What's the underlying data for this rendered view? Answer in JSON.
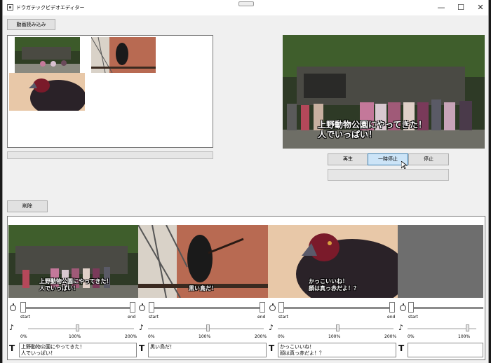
{
  "window": {
    "title": "ドウガテックビデオエディター"
  },
  "controls": {
    "minimize": "—",
    "maximize": "☐",
    "close": "✕"
  },
  "toolbar": {
    "load_label": "動画読み込み",
    "delete_label": "削除"
  },
  "player": {
    "subtitle": "上野動物公園にやってきた！\n人でいっぱい！",
    "play_label": "再生",
    "pause_label": "一時停止",
    "stop_label": "停止"
  },
  "timeline": {
    "start_label": "start",
    "end_label": "end",
    "vol_min": "0%",
    "vol_mid": "100%",
    "vol_max": "200%",
    "clips": [
      {
        "subtitle": "上野動物公園にやってきた！\n人でいっぱい！",
        "text": "上野動物公園にやってきた！\n人でいっぱい！",
        "has_end": true,
        "volume": 0.5
      },
      {
        "subtitle": "黒い鳥だ！",
        "text": "黒い鳥だ！",
        "has_end": true,
        "volume": 0.5
      },
      {
        "subtitle": "かっこいいね！\n顔は真っ赤だよ！？",
        "text": "かっこいいね！\n顔は真っ赤だよ！？",
        "has_end": true,
        "volume": 0.5
      },
      {
        "subtitle": "",
        "text": "",
        "has_end": false,
        "volume": 0.5
      }
    ]
  },
  "colors": {
    "accent": "#cce4f7",
    "accent_border": "#3c7fb1"
  }
}
